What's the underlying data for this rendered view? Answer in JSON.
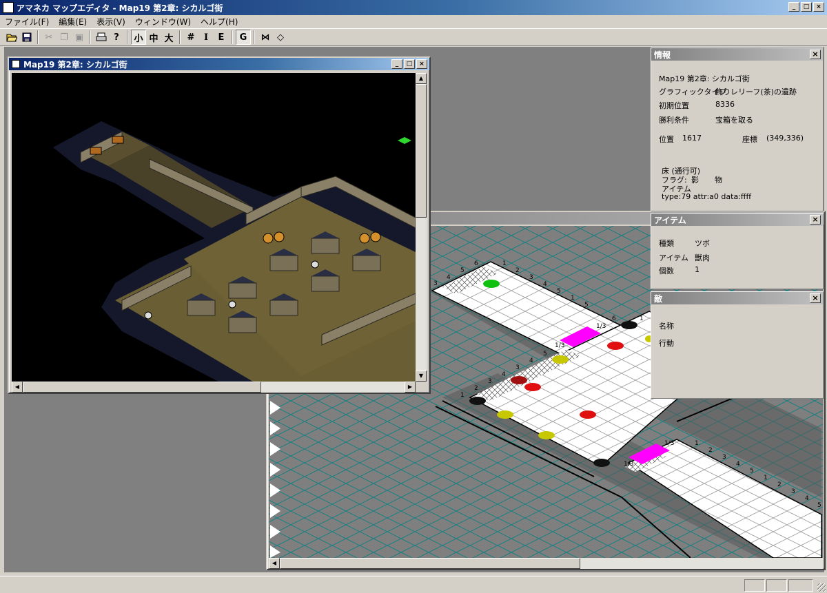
{
  "app": {
    "title": "アマネカ マップエディタ - Map19 第2章: シカルゴ街"
  },
  "menu": [
    "ファイル(F)",
    "編集(E)",
    "表示(V)",
    "ウィンドウ(W)",
    "ヘルプ(H)"
  ],
  "toolbar": {
    "size_small": "小",
    "size_medium": "中",
    "size_large": "大",
    "item_mode": "I",
    "enemy_mode": "E",
    "grid_mode": "G"
  },
  "map_window": {
    "title": "Map19 第2章: シカルゴ街"
  },
  "info_panel": {
    "title": "情報",
    "map_name": "Map19 第2章: シカルゴ街",
    "graphic_type_label": "グラフィックタイプ",
    "graphic_type_value": "飾りレリーフ(茶)の遺跡",
    "initial_pos_label": "初期位置",
    "initial_pos_value": "8336",
    "win_label": "勝利条件",
    "win_value": "宝箱を取る",
    "position_label": "位置",
    "position_value": "1617",
    "coord_label": "座標",
    "coord_value": "(349,336)",
    "floor": "床 (通行可)",
    "flag_label": "フラグ:",
    "flag_shadow": "影",
    "flag_object": "物",
    "item_label": "アイテム",
    "type_line": "type:79 attr:a0 data:ffff"
  },
  "item_panel": {
    "title": "アイテム",
    "kind_label": "種類",
    "kind_value": "ツボ",
    "item_label": "アイテム",
    "item_value": "獣肉",
    "count_label": "個数",
    "count_value": "1"
  },
  "enemy_panel": {
    "title": "敵",
    "name_label": "名称",
    "action_label": "行動"
  },
  "iso_labels": {
    "top_row": [
      "3",
      "4",
      "5",
      "6",
      "1",
      "2",
      "3",
      "4",
      "5",
      "1",
      "5",
      "6",
      "1"
    ],
    "mid_row": [
      "1/3",
      "1/3",
      "5",
      "4",
      "3",
      "4",
      "2",
      "3",
      "1"
    ],
    "bottom": [
      "1/3",
      "1",
      "1/3",
      "2",
      "3",
      "4",
      "5",
      "1",
      "2",
      "3",
      "4",
      "5"
    ]
  },
  "colors": {
    "title_active": "#0a246a",
    "magenta": "#ff00ff",
    "red": "#e01010",
    "yellow": "#c8c800",
    "green": "#10c010",
    "darkred": "#a01010",
    "grid": "#1a8080"
  }
}
